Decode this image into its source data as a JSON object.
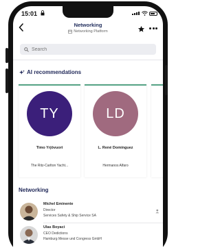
{
  "status_bar": {
    "time": "15:01"
  },
  "header": {
    "title": "Networking",
    "subtitle": "Networking Platform"
  },
  "search": {
    "placeholder": "Search"
  },
  "ai_section": {
    "title": "AI recommendations"
  },
  "recommendations": [
    {
      "initials": "TY",
      "name": "Timo Yrjövuori",
      "organization": "The Ritz-Carlton Yacht...",
      "color": "#3b1f7a"
    },
    {
      "initials": "LD",
      "name": "L. René Domínguez",
      "organization": "Hermanos Alfaro",
      "color": "#a06a7f"
    }
  ],
  "networking_section": {
    "title": "Networking"
  },
  "people": [
    {
      "name": "Michel Eminente",
      "role": "Director",
      "company": "Services Safety & Ship Service SA"
    },
    {
      "name": "Ulas Boyaci",
      "role": "CEO Dedictions",
      "company": "Hamburg Messe und Congress GmbH"
    }
  ],
  "colors": {
    "accent": "#55a385",
    "heading": "#222a5a",
    "search_bg": "#ecedf1"
  },
  "icons": [
    "back-chevron-icon",
    "calendar-icon",
    "star-icon",
    "more-icon",
    "search-icon",
    "sparkle-icon",
    "person-add-icon",
    "lock-icon",
    "wifi-icon",
    "signal-icon",
    "battery-icon"
  ]
}
